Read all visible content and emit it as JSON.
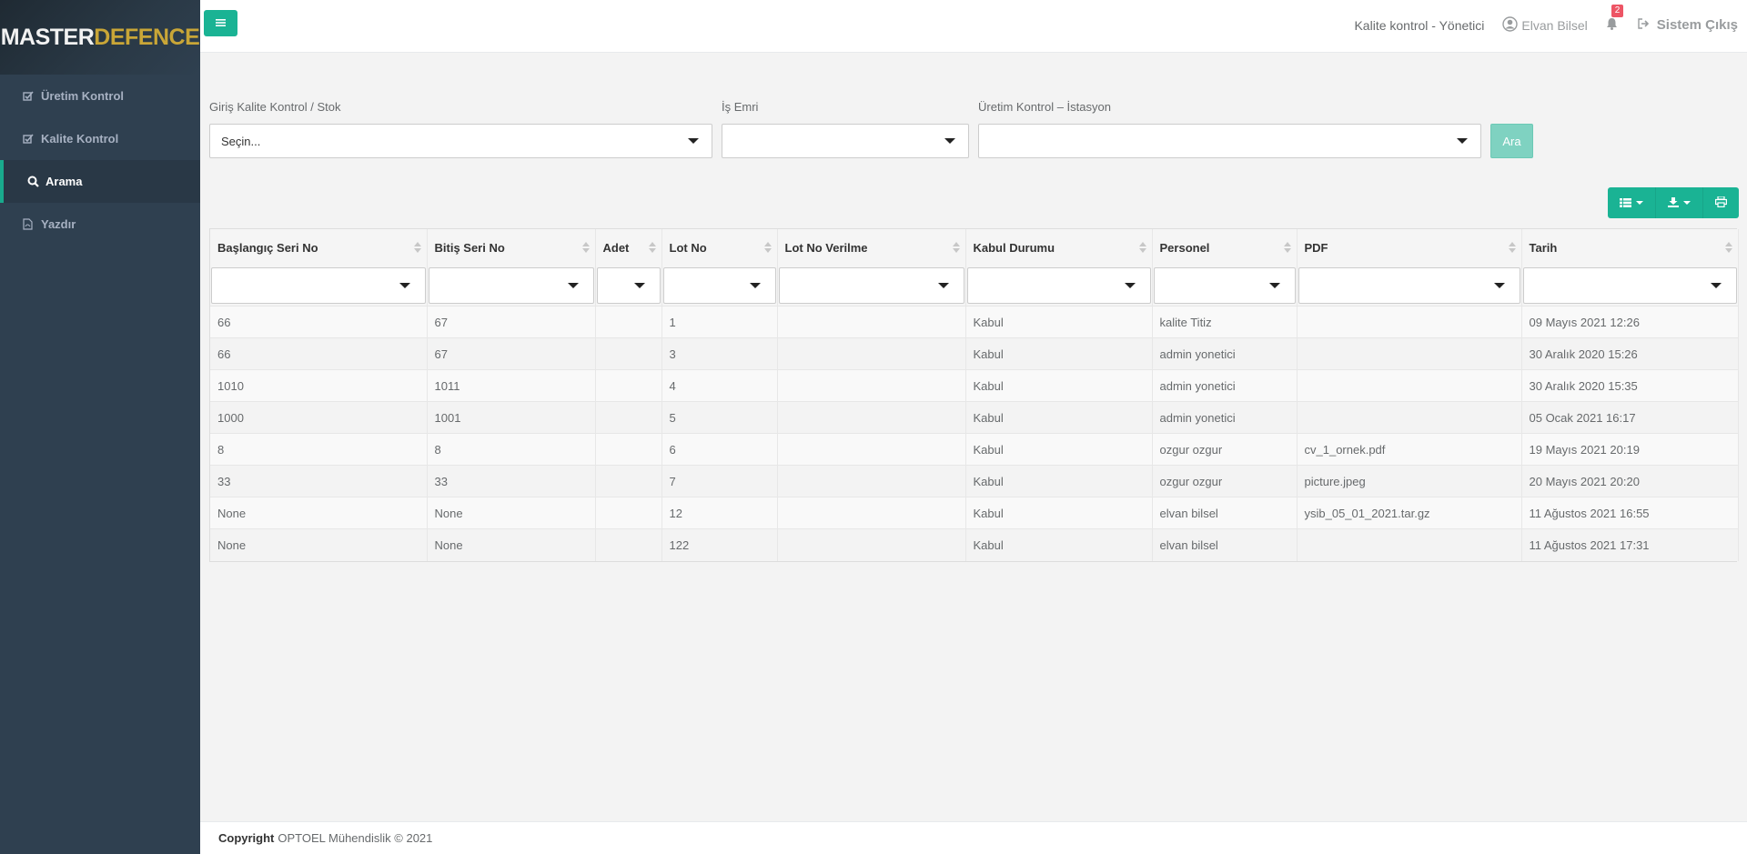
{
  "brand": {
    "part1": "MASTER",
    "part2": "DEFENCE"
  },
  "sidebar": {
    "items": [
      {
        "label": "Üretim Kontrol",
        "icon": "check-square-icon"
      },
      {
        "label": "Kalite Kontrol",
        "icon": "check-square-icon"
      },
      {
        "label": "Arama",
        "icon": "search-icon",
        "active": true
      },
      {
        "label": "Yazdır",
        "icon": "file-pdf-icon"
      }
    ]
  },
  "topbar": {
    "role": "Kalite kontrol - Yönetici",
    "user": "Elvan Bilsel",
    "notification_count": "2",
    "logout": "Sistem Çıkış"
  },
  "filters": {
    "stock_label": "Giriş Kalite Kontrol / Stok",
    "stock_value": "Seçin...",
    "work_order_label": "İş Emri",
    "work_order_value": "",
    "station_label": "Üretim Kontrol – İstasyon",
    "station_value": "",
    "search_button": "Ara"
  },
  "table": {
    "columns": [
      "Başlangıç Seri No",
      "Bitiş Seri No",
      "Adet",
      "Lot No",
      "Lot No Verilme",
      "Kabul Durumu",
      "Personel",
      "PDF",
      "Tarih"
    ],
    "rows": [
      [
        "66",
        "67",
        "",
        "1",
        "",
        "Kabul",
        "kalite Titiz",
        "",
        "09 Mayıs 2021 12:26"
      ],
      [
        "66",
        "67",
        "",
        "3",
        "",
        "Kabul",
        "admin yonetici",
        "",
        "30 Aralık 2020 15:26"
      ],
      [
        "1010",
        "1011",
        "",
        "4",
        "",
        "Kabul",
        "admin yonetici",
        "",
        "30 Aralık 2020 15:35"
      ],
      [
        "1000",
        "1001",
        "",
        "5",
        "",
        "Kabul",
        "admin yonetici",
        "",
        "05 Ocak 2021 16:17"
      ],
      [
        "8",
        "8",
        "",
        "6",
        "",
        "Kabul",
        "ozgur ozgur",
        "cv_1_ornek.pdf",
        "19 Mayıs 2021 20:19"
      ],
      [
        "33",
        "33",
        "",
        "7",
        "",
        "Kabul",
        "ozgur ozgur",
        "picture.jpeg",
        "20 Mayıs 2021 20:20"
      ],
      [
        "None",
        "None",
        "",
        "12",
        "",
        "Kabul",
        "elvan bilsel",
        "ysib_05_01_2021.tar.gz",
        "11 Ağustos 2021 16:55"
      ],
      [
        "None",
        "None",
        "",
        "122",
        "",
        "Kabul",
        "elvan bilsel",
        "",
        "11 Ağustos 2021 17:31"
      ]
    ]
  },
  "footer": {
    "copyright_label": "Copyright",
    "text": "OPTOEL Mühendislik © 2021"
  },
  "colors": {
    "accent": "#1ab394",
    "sidebar": "#2f4050",
    "logo_gold": "#c9a637",
    "badge": "#ed5565",
    "link": "#337ab7"
  }
}
